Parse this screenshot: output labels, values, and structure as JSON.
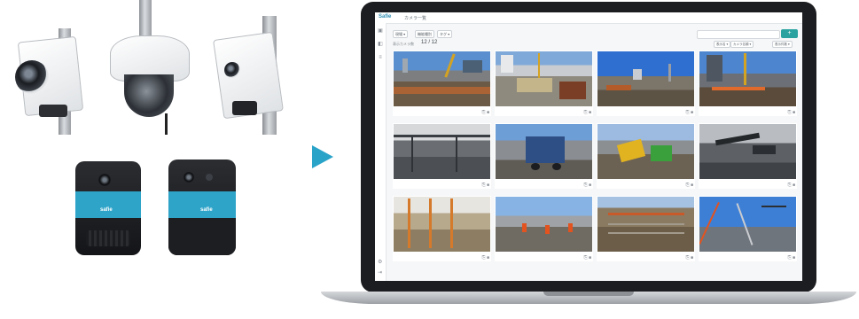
{
  "devices": {
    "fixed_cameras": [
      "fixed-camera-1",
      "dome-camera",
      "fixed-camera-2"
    ],
    "body_cameras": [
      {
        "brand": "safie"
      },
      {
        "brand": "safie"
      }
    ]
  },
  "arrow_color": "#2aa3c9",
  "app": {
    "logo": "Safie",
    "breadcrumb": "カメラ一覧",
    "filter_chips": [
      "現場 ▾",
      "機能種別",
      "タグ ▾"
    ],
    "search_placeholder": "",
    "add_button": "+",
    "count_label": "表示カメラ数",
    "count_value": "12 / 12",
    "sort_options": [
      "表示名 ▾",
      "カメラ名順 ▾",
      "表示件数 ▾"
    ],
    "sidebar_icons": [
      "camera-icon",
      "map-icon",
      "list-icon"
    ],
    "bottom_icons": [
      "gear-icon",
      "logout-icon"
    ],
    "tile_footer": "⎘ ■",
    "accent": "#2aa3a0"
  },
  "tiles": [
    {
      "scene": "site-overview"
    },
    {
      "scene": "site-city"
    },
    {
      "scene": "site-sky"
    },
    {
      "scene": "tower-crane"
    },
    {
      "scene": "steel-frame"
    },
    {
      "scene": "truck"
    },
    {
      "scene": "excavator"
    },
    {
      "scene": "pipe-work"
    },
    {
      "scene": "scaffold"
    },
    {
      "scene": "cones"
    },
    {
      "scene": "rebar"
    },
    {
      "scene": "crane-sky"
    }
  ]
}
